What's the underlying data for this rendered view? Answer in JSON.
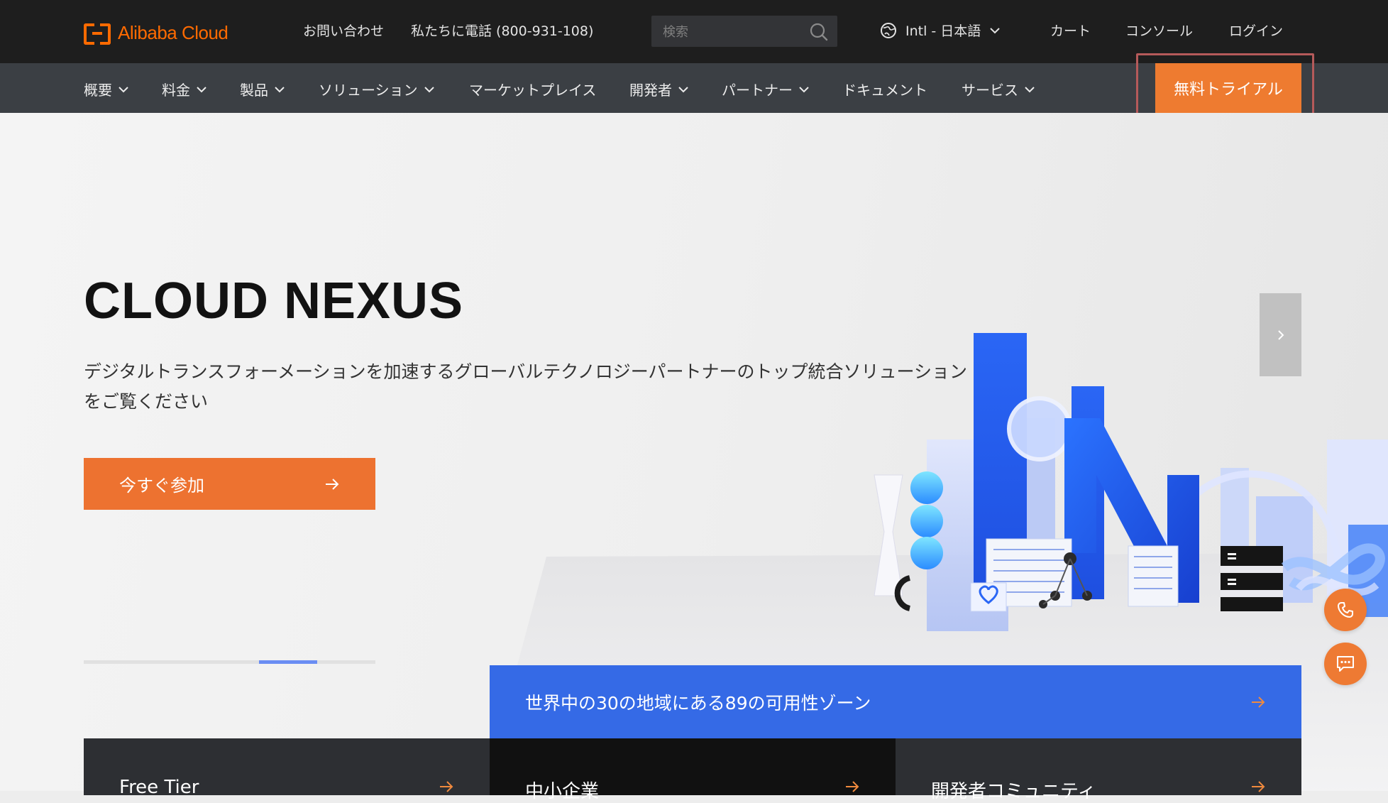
{
  "topbar": {
    "logo_text": "Alibaba Cloud",
    "contact": "お問い合わせ",
    "phone": "私たちに電話 (800-931-108)",
    "search_placeholder": "検索",
    "language": "Intl - 日本語",
    "cart": "カート",
    "console": "コンソール",
    "login": "ログイン"
  },
  "nav": {
    "items": [
      {
        "label": "概要"
      },
      {
        "label": "料金"
      },
      {
        "label": "製品"
      },
      {
        "label": "ソリューション"
      },
      {
        "label": "マーケットプレイス"
      },
      {
        "label": "開発者"
      },
      {
        "label": "パートナー"
      },
      {
        "label": "ドキュメント"
      },
      {
        "label": "サービス"
      }
    ],
    "trial": "無料トライアル"
  },
  "hero": {
    "title": "CLOUD NEXUS",
    "description": "デジタルトランスフォーメーションを加速するグローバルテクノロジーパートナーのトップ統合ソリューションをご覧ください",
    "cta": "今すぐ参加",
    "carousel_progress": 0.2
  },
  "zone_banner": "世界中の30の地域にある89の可用性ゾーン",
  "cards": [
    {
      "label": "Free Tier"
    },
    {
      "label": "中小企業"
    },
    {
      "label": "開発者コミュニティ"
    }
  ],
  "colors": {
    "accent": "#ed7230",
    "brand": "#ff6a00",
    "topbar": "#1e1e1e",
    "navbar": "#3b3f44",
    "banner": "#356ae6"
  },
  "icons": {
    "search": "search-icon",
    "globe": "globe-icon",
    "chevron": "chevron-down-icon",
    "arrow": "arrow-right-icon",
    "phone": "phone-icon",
    "chat": "chat-icon"
  }
}
